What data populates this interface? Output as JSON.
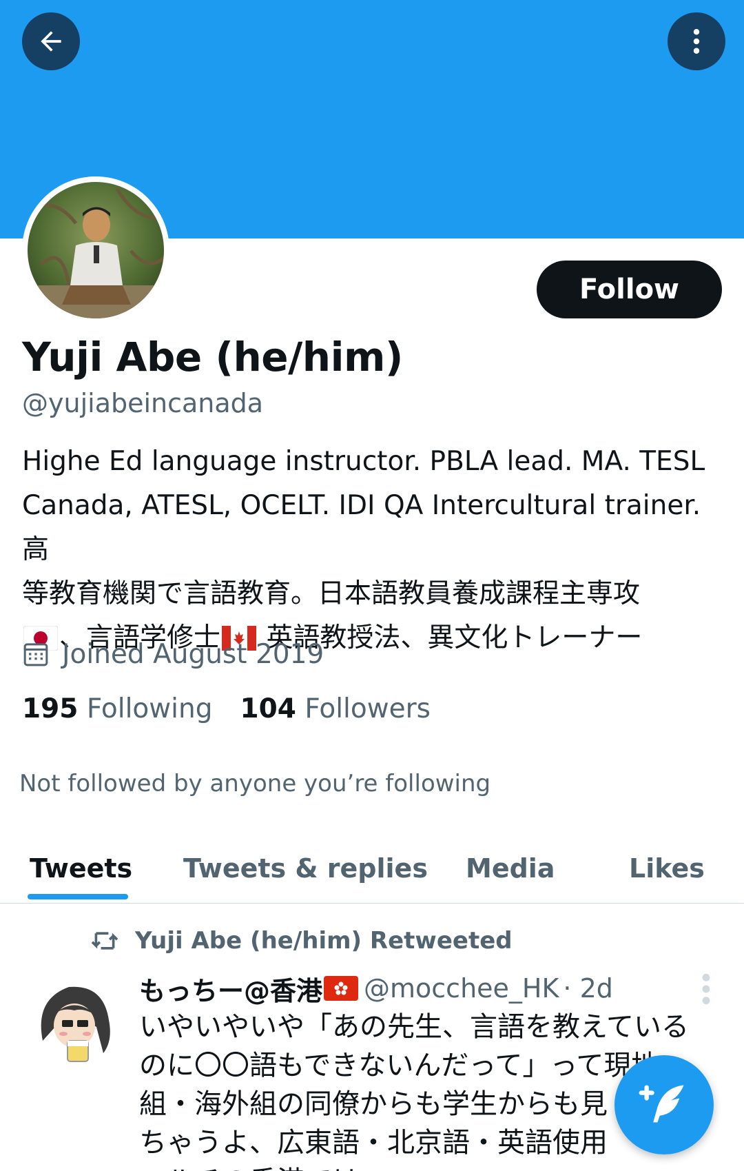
{
  "colors": {
    "banner": "#1d9bf0",
    "accent": "#1d9bf0",
    "header_button_bg": "#163f64",
    "follow_button_bg": "#0f1419",
    "text_primary": "#0f1419",
    "text_secondary": "#536471"
  },
  "header": {
    "back_icon": "arrow-left-icon",
    "more_icon": "vertical-dots-icon"
  },
  "profile": {
    "follow_label": "Follow",
    "display_name": "Yuji Abe (he/him)",
    "handle": "@yujiabeincanada",
    "bio_line_1": "Highe Ed language instructor. PBLA lead. MA. TESL",
    "bio_line_2": "Canada, ATESL, OCELT. IDI QA Intercultural trainer.高",
    "bio_line_3": "等教育機関で言語教育。日本語教員養成課程主専攻",
    "bio_line_4_a": "、言語学修士",
    "bio_line_4_b": " 英語教授法、異文化トレーナー",
    "joined": "Joined August 2019",
    "following_count": "195",
    "following_label": "Following",
    "followers_count": "104",
    "followers_label": "Followers",
    "not_followed": "Not followed by anyone you’re following"
  },
  "tabs": [
    {
      "label": "Tweets",
      "active": true
    },
    {
      "label": "Tweets & replies",
      "active": false
    },
    {
      "label": "Media",
      "active": false
    },
    {
      "label": "Likes",
      "active": false
    }
  ],
  "tweet": {
    "retweeted_by": "Yuji Abe (he/him) Retweeted",
    "author_name": "もっちー@香港",
    "author_handle": "@mocchee_HK",
    "time": "· 2d",
    "text_lines": [
      "いやいやいや「あの先生、言語を教えている",
      "のに〇〇語もできないんだって」って現地",
      "組・海外組の同僚からも学生からも見",
      "ちゃうよ、広東語・北京語・英語使用",
      "マルチの香港では"
    ]
  },
  "fab": {
    "icon": "compose-tweet-icon"
  }
}
